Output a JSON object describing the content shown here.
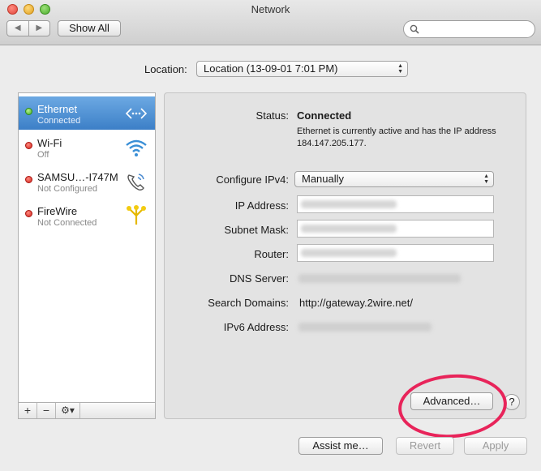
{
  "window": {
    "title": "Network",
    "show_all": "Show All",
    "nav_back": "◀",
    "nav_forward": "▶"
  },
  "location": {
    "label": "Location:",
    "value": "Location (13-09-01 7:01 PM)"
  },
  "services": [
    {
      "name": "Ethernet",
      "status": "Connected",
      "dot": "green",
      "icon": "ethernet-icon",
      "selected": true
    },
    {
      "name": "Wi-Fi",
      "status": "Off",
      "dot": "red",
      "icon": "wifi-icon",
      "selected": false
    },
    {
      "name": "SAMSU…-I747M",
      "status": "Not Configured",
      "dot": "red",
      "icon": "phone-icon",
      "selected": false
    },
    {
      "name": "FireWire",
      "status": "Not Connected",
      "dot": "red",
      "icon": "firewire-icon",
      "selected": false
    }
  ],
  "sidebar_bar": {
    "add": "+",
    "remove": "−",
    "gear": "⚙▾"
  },
  "detail": {
    "status_label": "Status:",
    "status_value": "Connected",
    "status_desc": "Ethernet is currently active and has the IP address 184.147.205.177.",
    "configure_label": "Configure IPv4:",
    "configure_value": "Manually",
    "ip_label": "IP Address:",
    "subnet_label": "Subnet Mask:",
    "router_label": "Router:",
    "dns_label": "DNS Server:",
    "search_label": "Search Domains:",
    "search_value": "http://gateway.2wire.net/",
    "ipv6_label": "IPv6 Address:"
  },
  "buttons": {
    "advanced": "Advanced…",
    "help": "?",
    "assist": "Assist me…",
    "revert": "Revert",
    "apply": "Apply"
  },
  "colors": {
    "selection": "#3c7fc7",
    "annotation_ring": "#e8245a"
  }
}
